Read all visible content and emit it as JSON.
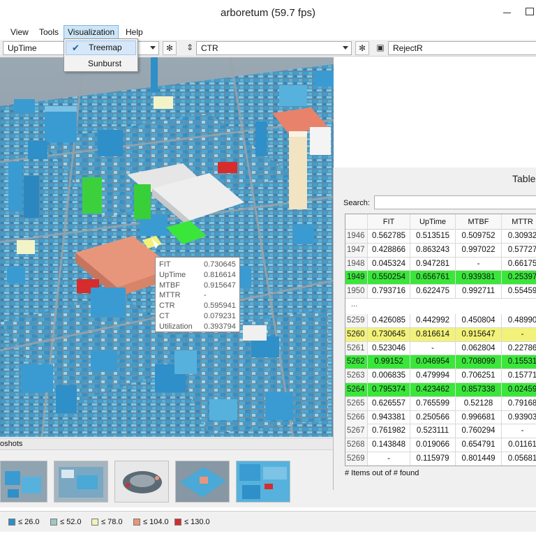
{
  "window": {
    "title": "arboretum  (59.7 fps)"
  },
  "menu": {
    "view": "View",
    "tools": "Tools",
    "visualization": "Visualization",
    "help": "Help"
  },
  "visualization_menu": {
    "items": [
      {
        "label": "Treemap",
        "checked": true
      },
      {
        "label": "Sunburst",
        "checked": false
      }
    ]
  },
  "toolbar": {
    "size_metric": "UpTime",
    "color_metric": "CTR",
    "filter_metric": "RejectR"
  },
  "tooltip": {
    "rows": [
      {
        "label": "FIT",
        "value": "0.730645"
      },
      {
        "label": "UpTime",
        "value": "0.816614"
      },
      {
        "label": "MTBF",
        "value": "0.915647"
      },
      {
        "label": "MTTR",
        "value": "-"
      },
      {
        "label": "CTR",
        "value": "0.595941"
      },
      {
        "label": "CT",
        "value": "0.079231"
      },
      {
        "label": "Utilization",
        "value": "0.393794"
      }
    ]
  },
  "table_panel": {
    "title": "Table",
    "search_label": "Search:",
    "search_value": "",
    "columns": [
      "FIT",
      "UpTime",
      "MTBF",
      "MTTR"
    ],
    "ellipsis": "...",
    "rows_top": [
      {
        "id": "1946",
        "cells": [
          "0.562785",
          "0.513515",
          "0.509752",
          "0.30932"
        ],
        "highlight": ""
      },
      {
        "id": "1947",
        "cells": [
          "0.428866",
          "0.863243",
          "0.997022",
          "0.57727"
        ],
        "highlight": ""
      },
      {
        "id": "1948",
        "cells": [
          "0.045324",
          "0.947281",
          "-",
          "0.66175"
        ],
        "highlight": ""
      },
      {
        "id": "1949",
        "cells": [
          "0.550254",
          "0.656761",
          "0.939381",
          "0.25397"
        ],
        "highlight": "green"
      },
      {
        "id": "1950",
        "cells": [
          "0.793716",
          "0.622475",
          "0.992711",
          "0.55459"
        ],
        "highlight": ""
      }
    ],
    "rows_bottom": [
      {
        "id": "5259",
        "cells": [
          "0.426085",
          "0.442992",
          "0.450804",
          "0.48990"
        ],
        "highlight": ""
      },
      {
        "id": "5260",
        "cells": [
          "0.730645",
          "0.816614",
          "0.915647",
          "-"
        ],
        "highlight": "yellow"
      },
      {
        "id": "5261",
        "cells": [
          "0.523046",
          "-",
          "0.062804",
          "0.22786"
        ],
        "highlight": ""
      },
      {
        "id": "5262",
        "cells": [
          "0.99152",
          "0.046954",
          "0.708099",
          "0.15531"
        ],
        "highlight": "green"
      },
      {
        "id": "5263",
        "cells": [
          "0.006835",
          "0.479994",
          "0.706251",
          "0.15771"
        ],
        "highlight": ""
      },
      {
        "id": "5264",
        "cells": [
          "0.795374",
          "0.423462",
          "0.857338",
          "0.02459"
        ],
        "highlight": "green"
      },
      {
        "id": "5265",
        "cells": [
          "0.626557",
          "0.765599",
          "0.52128",
          "0.79168"
        ],
        "highlight": ""
      },
      {
        "id": "5266",
        "cells": [
          "0.943381",
          "0.250566",
          "0.996681",
          "0.93903"
        ],
        "highlight": ""
      },
      {
        "id": "5267",
        "cells": [
          "0.761982",
          "0.523111",
          "0.760294",
          "-"
        ],
        "highlight": ""
      },
      {
        "id": "5268",
        "cells": [
          "0.143848",
          "0.019066",
          "0.654791",
          "0.01161"
        ],
        "highlight": ""
      },
      {
        "id": "5269",
        "cells": [
          "-",
          "0.115979",
          "0.801449",
          "0.05681"
        ],
        "highlight": ""
      }
    ],
    "footer": "# Items out of # found"
  },
  "snapshots": {
    "title": "oshots"
  },
  "legend": [
    {
      "label": "≤ 26.0",
      "color": "#2f8fc8"
    },
    {
      "label": "≤ 52.0",
      "color": "#9fc6c4"
    },
    {
      "label": "≤ 78.0",
      "color": "#f3f3b8"
    },
    {
      "label": "≤ 104.0",
      "color": "#e8957a"
    },
    {
      "label": "≤ 130.0",
      "color": "#d62c2c"
    }
  ],
  "colors": {
    "highlight_green": "#3be63b",
    "highlight_yellow": "#f2f27a",
    "accent_blue": "#2f8fc8"
  }
}
